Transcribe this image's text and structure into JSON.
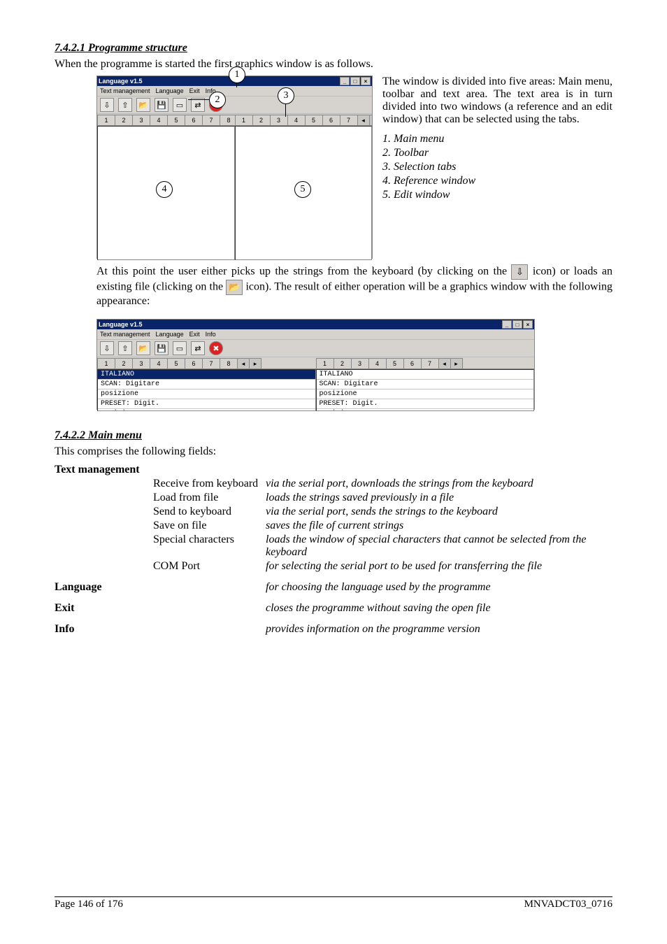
{
  "section1_heading": "7.4.2.1    Programme structure",
  "section1_intro": "When the programme is started the first graphics window is as follows.",
  "side_para": "The window is divided into five areas: Main menu, toolbar and text area. The text area is in turn divided into two windows (a reference and an edit window)  that can be selected using the tabs.",
  "side_items": [
    "1.   Main menu",
    "2.   Toolbar",
    "3.   Selection tabs",
    "4.   Reference window",
    "5.   Edit window"
  ],
  "after_shot1_a": "At this point the user either picks up the strings from the keyboard (by clicking on the ",
  "after_shot1_b": " icon) or loads an existing file (clicking on the ",
  "after_shot1_c": " icon). The result of either operation will be a graphics window with the following appearance:",
  "section2_heading": "7.4.2.2    Main menu",
  "section2_intro": "This comprises the following fields:",
  "menu_rows": [
    {
      "c1": "Text management",
      "c2": "",
      "c3": ""
    },
    {
      "c1": "",
      "c2": "Receive from keyboard",
      "c3": "via the serial port, downloads the strings from the keyboard"
    },
    {
      "c1": "",
      "c2": "Load from file",
      "c3": "loads the strings saved previously in a file"
    },
    {
      "c1": "",
      "c2": "Send to keyboard",
      "c3": "via the serial port, sends the strings to the keyboard"
    },
    {
      "c1": "",
      "c2": "Save on file",
      "c3": "saves the file of current strings"
    },
    {
      "c1": "",
      "c2": "Special characters",
      "c3": "loads the window of special characters that cannot be selected from the keyboard"
    },
    {
      "c1": "",
      "c2": "COM Port",
      "c3": "for selecting the serial port to be used for transferring the file"
    },
    {
      "c1": "Language",
      "c2": "",
      "c3": "for choosing the language used by the programme"
    },
    {
      "c1": "Exit",
      "c2": "",
      "c3": "closes the programme without saving the open file"
    },
    {
      "c1": "Info",
      "c2": "",
      "c3": "provides information on the programme version"
    }
  ],
  "footer_left": "Page 146 of 176",
  "footer_right": "MNVADCT03_0716",
  "app_title": "Language v1.5",
  "menubar_items": [
    "Text management",
    "Language",
    "Exit",
    "Info"
  ],
  "toolbar_icons": [
    "⇩",
    "⇧",
    "📂",
    "💾",
    "▭",
    "⇄",
    "✖"
  ],
  "tabs": [
    "1",
    "2",
    "3",
    "4",
    "5",
    "6",
    "7",
    "8"
  ],
  "tab_scroll": [
    "◂",
    "▸"
  ],
  "callouts": [
    "1",
    "2",
    "3",
    "4",
    "5"
  ],
  "pane_rows": [
    "ITALIANO",
    "SCAN: Digitare",
    "posizione",
    "PRESET: Digit.",
    "posizione"
  ],
  "winbtns": [
    "_",
    "□",
    "×"
  ],
  "inline_icon_kb": "⇩",
  "inline_icon_folder": "📂"
}
